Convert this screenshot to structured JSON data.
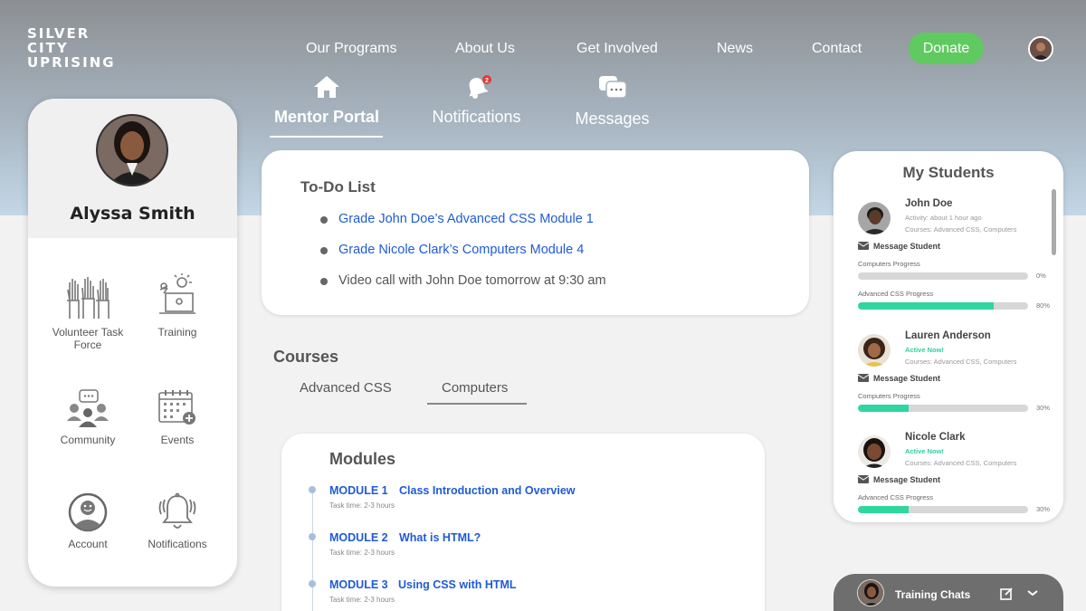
{
  "brand": {
    "logo_lines": [
      "SILVER",
      "CITY",
      "UPRISING"
    ]
  },
  "nav": {
    "items": [
      "Our Programs",
      "About Us",
      "Get Involved",
      "News",
      "Contact"
    ],
    "donate": "Donate"
  },
  "portal_tabs": [
    {
      "label": "Mentor Portal",
      "icon": "home-icon",
      "active": true
    },
    {
      "label": "Notifications",
      "icon": "bell-icon",
      "badge": "2"
    },
    {
      "label": "Messages",
      "icon": "chat-bubbles-icon"
    }
  ],
  "profile": {
    "name": "Alyssa Smith",
    "tiles": [
      {
        "label": "Volunteer Task Force",
        "icon": "raised-hands-icon"
      },
      {
        "label": "Training",
        "icon": "presentation-icon"
      },
      {
        "label": "Community",
        "icon": "community-icon"
      },
      {
        "label": "Events",
        "icon": "calendar-add-icon"
      },
      {
        "label": "Account",
        "icon": "account-icon"
      },
      {
        "label": "Notifications",
        "icon": "ringing-bell-icon"
      }
    ]
  },
  "todo": {
    "title": "To-Do List",
    "items": [
      {
        "text": "Grade John Doe’s Advanced CSS Module 1",
        "link": true
      },
      {
        "text": "Grade Nicole Clark’s Computers Module 4",
        "link": true
      },
      {
        "text": "Video call with John Doe tomorrow at 9:30 am",
        "link": false
      }
    ]
  },
  "courses": {
    "title": "Courses",
    "tabs": [
      "Advanced CSS",
      "Computers"
    ],
    "selected": "Computers"
  },
  "modules": {
    "title": "Modules",
    "items": [
      {
        "number": "MODULE 1",
        "title": "Class Introduction and Overview",
        "time": "Task time: 2-3 hours"
      },
      {
        "number": "MODULE 2",
        "title": "What is HTML?",
        "time": "Task time: 2-3 hours"
      },
      {
        "number": "MODULE 3",
        "title": "Using CSS with HTML",
        "time": "Task time: 2-3 hours"
      }
    ]
  },
  "students": {
    "title": "My Students",
    "message_label": "Message Student",
    "list": [
      {
        "name": "John Doe",
        "status": "Activity: about 1 hour ago",
        "active": false,
        "courses": "Courses: Advanced CSS, Computers",
        "progress": [
          {
            "label": "Computers Progress",
            "value": 0,
            "pct": "0%"
          },
          {
            "label": "Advanced CSS Progress",
            "value": 80,
            "pct": "80%"
          }
        ]
      },
      {
        "name": "Lauren Anderson",
        "status": "Active Now!",
        "active": true,
        "courses": "Courses: Advanced CSS, Computers",
        "progress": [
          {
            "label": "Computers Progress",
            "value": 30,
            "pct": "30%"
          }
        ]
      },
      {
        "name": "Nicole Clark",
        "status": "Active Now!",
        "active": true,
        "courses": "Courses: Advanced CSS, Computers",
        "progress": [
          {
            "label": "Advanced CSS Progress",
            "value": 30,
            "pct": "30%"
          }
        ]
      }
    ]
  },
  "chat": {
    "label": "Training Chats"
  },
  "colors": {
    "accent_green": "#5fca5f",
    "progress": "#2fd6a0",
    "link": "#1f5bd6"
  }
}
